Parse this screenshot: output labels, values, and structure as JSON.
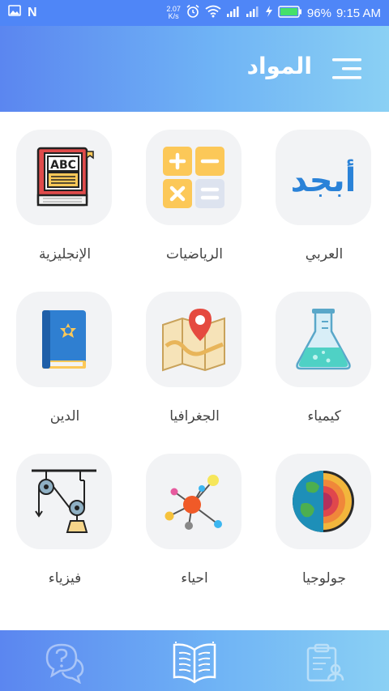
{
  "status_bar": {
    "net_speed": "2.07",
    "net_speed_unit": "K/s",
    "carrier_letter": "N",
    "battery": "96%",
    "time": "9:15 AM"
  },
  "header": {
    "title": "المواد",
    "menu_icon": "hamburger-menu-icon"
  },
  "subjects": [
    {
      "label": "العربي",
      "icon": "arabic-letters-icon"
    },
    {
      "label": "الرياضيات",
      "icon": "calculator-icon"
    },
    {
      "label": "الإنجليزية",
      "icon": "abc-book-icon"
    },
    {
      "label": "كيمياء",
      "icon": "flask-icon"
    },
    {
      "label": "الجغرافيا",
      "icon": "map-pin-icon"
    },
    {
      "label": "الدين",
      "icon": "quran-book-icon"
    },
    {
      "label": "جولوجيا",
      "icon": "earth-layers-icon"
    },
    {
      "label": "احياء",
      "icon": "molecule-icon"
    },
    {
      "label": "فيزياء",
      "icon": "pulley-icon"
    }
  ],
  "subject_icon_text": {
    "arabic": "أبجد",
    "english": "ABC"
  },
  "bottom_nav": [
    {
      "icon": "question-chat-icon",
      "active": false
    },
    {
      "icon": "open-book-icon",
      "active": true
    },
    {
      "icon": "clipboard-user-icon",
      "active": false
    }
  ],
  "colors": {
    "primary": "#4f86f7",
    "gradient_end": "#8ad0f4",
    "tile_bg": "#f2f3f5",
    "label_text": "#444444"
  }
}
